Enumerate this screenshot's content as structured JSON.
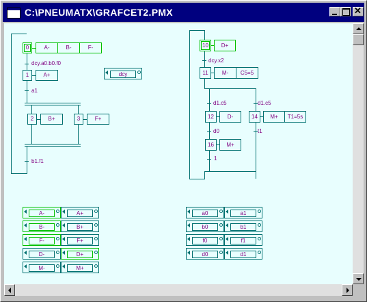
{
  "window": {
    "title": "C:\\PNEUMATX\\GRAFCET2.PMX"
  },
  "grafcet1": {
    "step0": "0",
    "actions0": [
      "A-",
      "B-",
      "F-"
    ],
    "t0": "dcy.a0.b0.f0",
    "step1": "1",
    "action1": "A+",
    "t1": "a1",
    "step2": "2",
    "action2": "B+",
    "step3": "3",
    "action3": "F+",
    "t_end": "b1.f1",
    "dcy_button": "dcy"
  },
  "grafcet2": {
    "step10": "10",
    "action10": "D+",
    "t10": "dcy.x2",
    "step11": "11",
    "action11": "M-",
    "cond11": "C5=5",
    "t11a": "d1.c5",
    "t11b": "d1.c5",
    "step12": "12",
    "action12": "D-",
    "step14": "14",
    "action14": "M+",
    "cond14": "T1=5s",
    "t12": "d0",
    "t14": "t1",
    "step16": "16",
    "action16": "M+",
    "t16": "1"
  },
  "outputs": [
    [
      "A-",
      "A+"
    ],
    [
      "B-",
      "B+"
    ],
    [
      "F-",
      "F+"
    ],
    [
      "D-",
      "D+"
    ],
    [
      "M-",
      "M+"
    ]
  ],
  "sensors": [
    [
      "a0",
      "a1"
    ],
    [
      "b0",
      "b1"
    ],
    [
      "f0",
      "f1"
    ],
    [
      "d0",
      "d1"
    ]
  ]
}
